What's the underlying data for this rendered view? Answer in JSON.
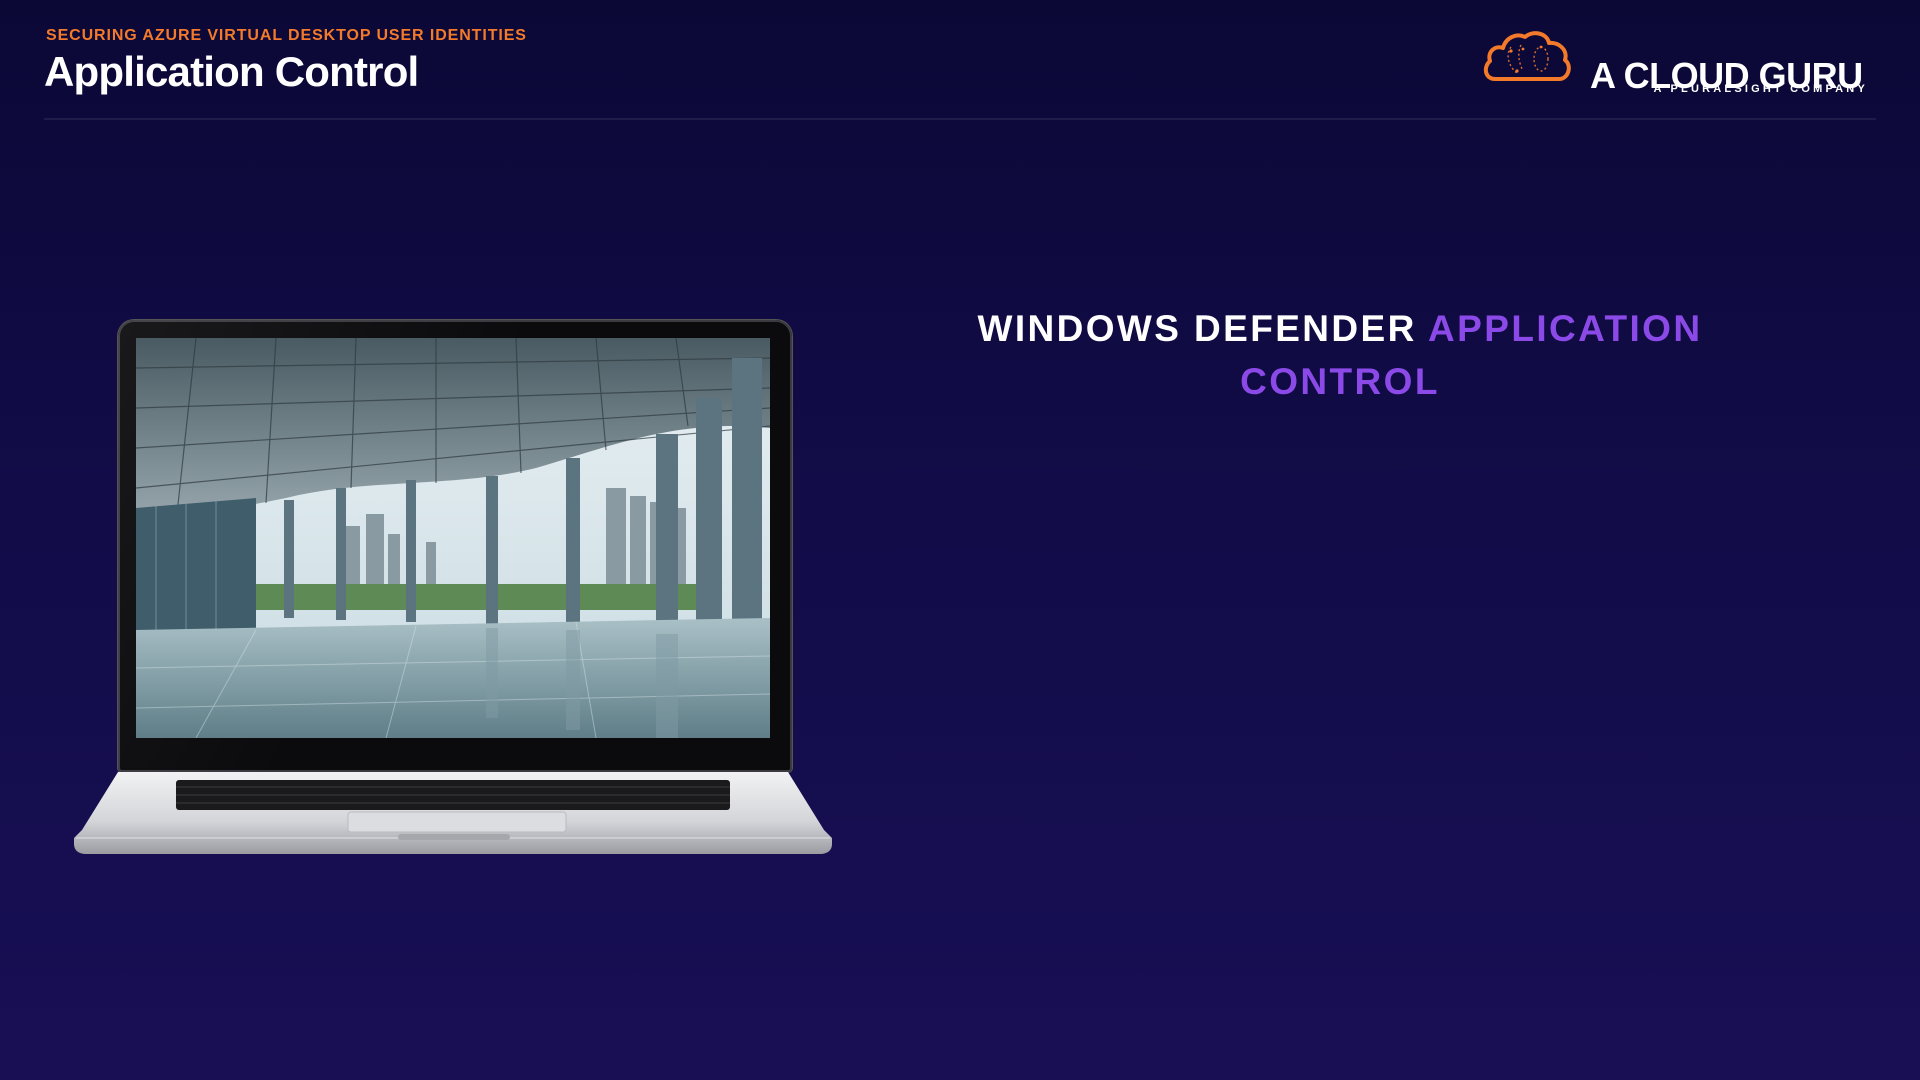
{
  "header": {
    "course": "SECURING AZURE VIRTUAL DESKTOP USER IDENTITIES",
    "title": "Application Control"
  },
  "brand": {
    "name": "A CLOUD GURU",
    "tagline": "A PLURALSIGHT COMPANY",
    "logo_icon": "cloud-logo-icon",
    "accent_color": "#f47a2b"
  },
  "content": {
    "heading_plain": "WINDOWS DEFENDER",
    "heading_accent_1": "APPLICATION",
    "heading_accent_2": "CONTROL",
    "accent_color": "#8b4ae8"
  },
  "illustration": {
    "device": "laptop",
    "screen_photo": "modern glass atrium with city skyline"
  },
  "colors": {
    "background_top": "#0b0836",
    "background_bottom": "#180f55",
    "eyebrow": "#f47a2b",
    "title": "#ffffff"
  }
}
